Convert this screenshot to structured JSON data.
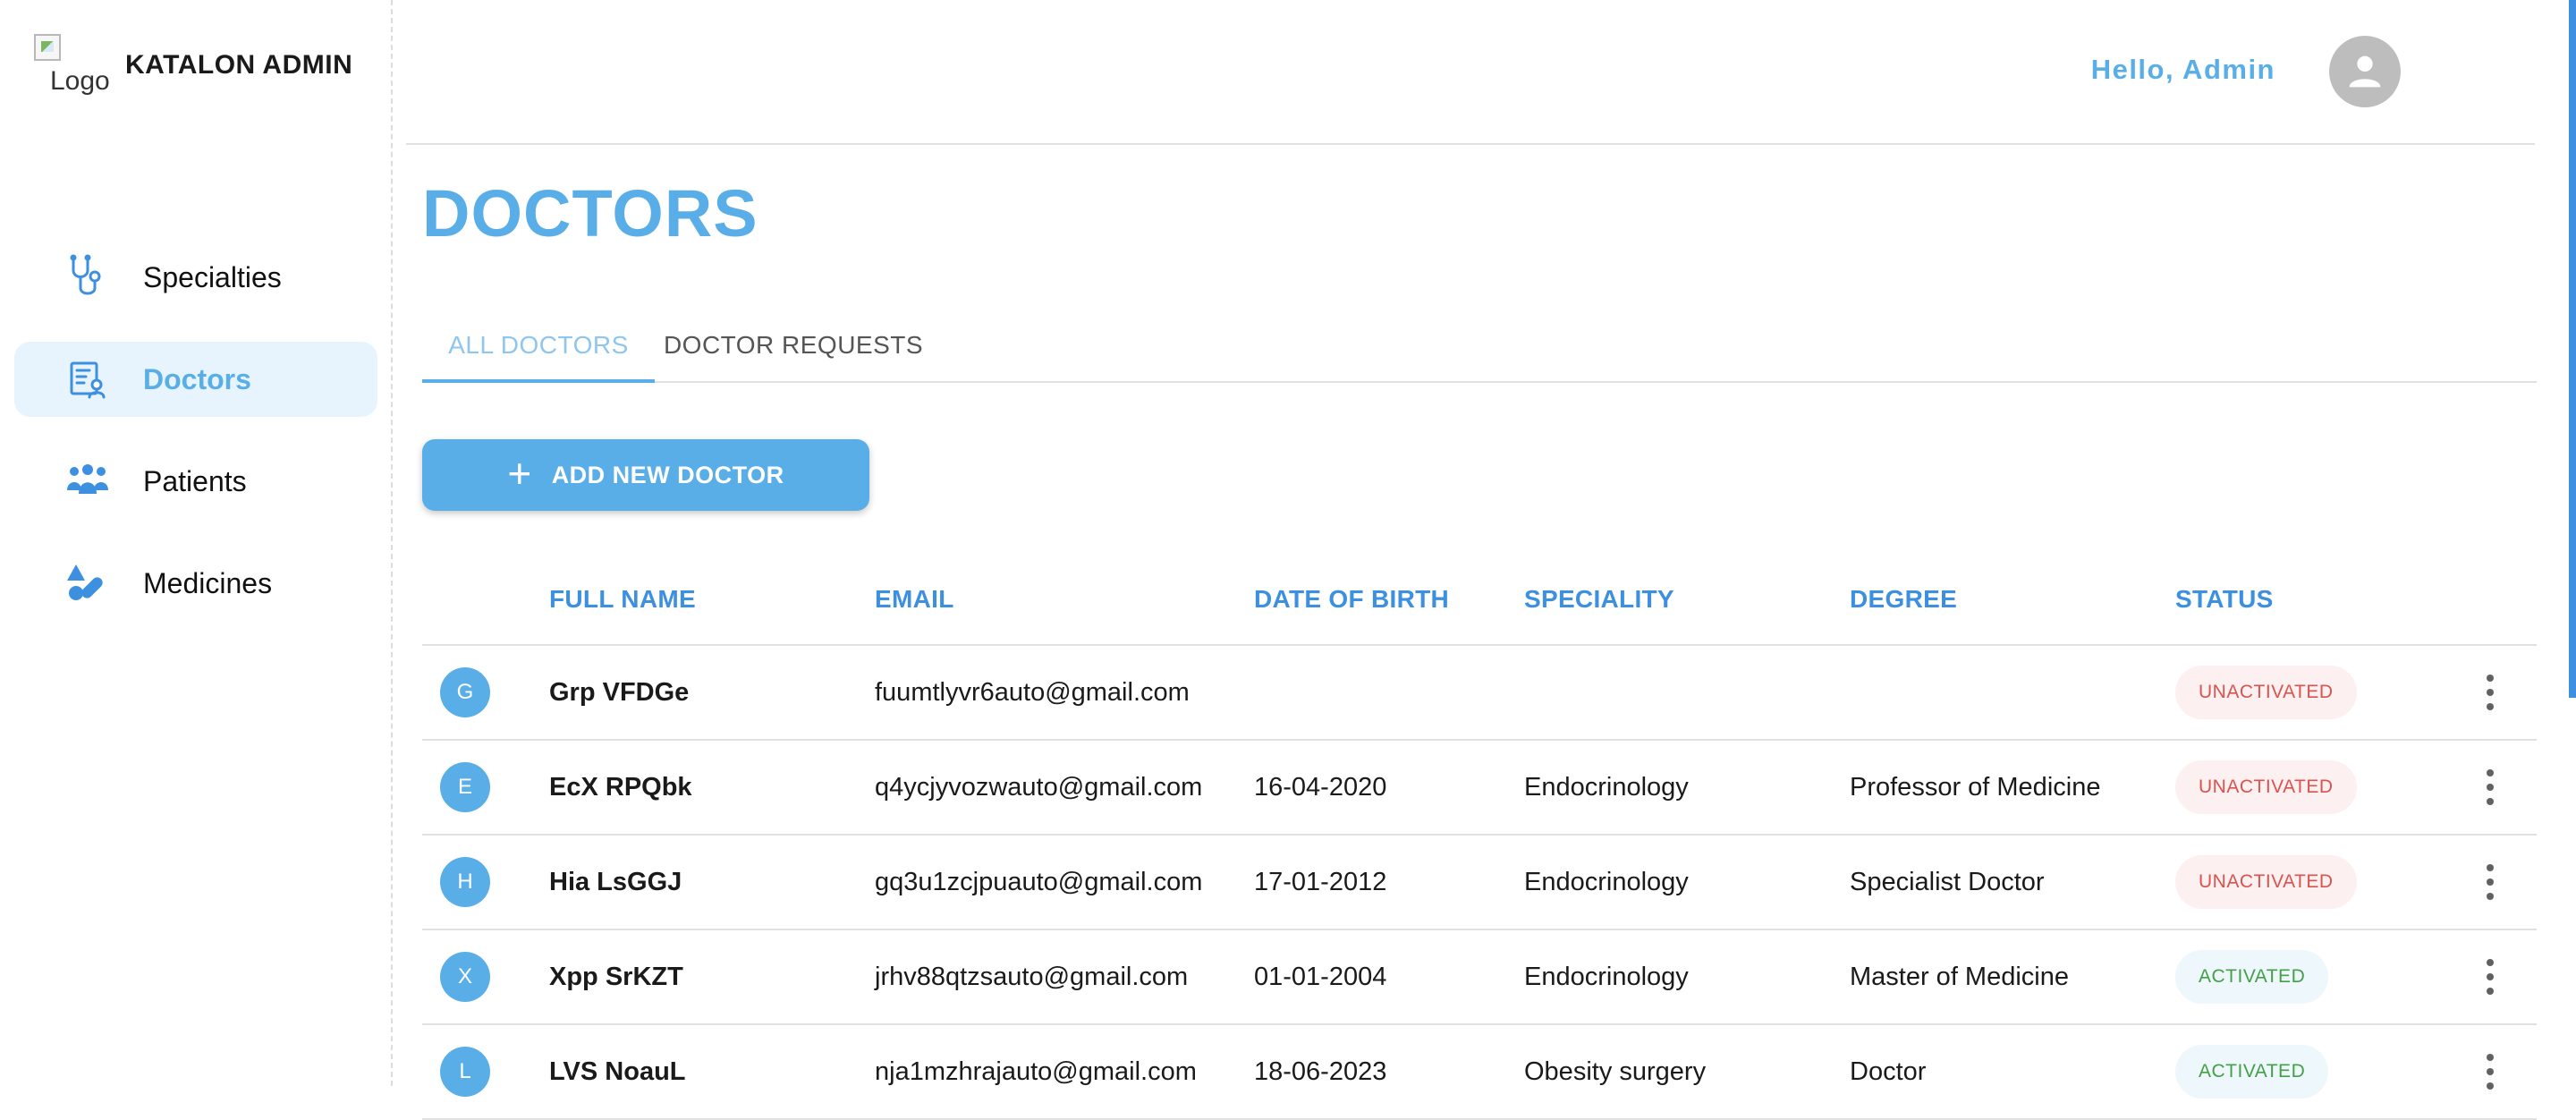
{
  "brand": {
    "logo_alt": "Logo",
    "name": "KATALON ADMIN"
  },
  "sidebar": {
    "items": [
      {
        "label": "Specialties",
        "icon": "stethoscope-icon",
        "active": false
      },
      {
        "label": "Doctors",
        "icon": "doctor-list-icon",
        "active": true
      },
      {
        "label": "Patients",
        "icon": "patients-icon",
        "active": false
      },
      {
        "label": "Medicines",
        "icon": "pills-icon",
        "active": false
      }
    ]
  },
  "header": {
    "greeting": "Hello, Admin",
    "avatar_icon": "account-circle-icon"
  },
  "page": {
    "title": "DOCTORS"
  },
  "tabs": [
    {
      "label": "ALL DOCTORS",
      "active": true
    },
    {
      "label": "DOCTOR REQUESTS",
      "active": false
    }
  ],
  "actions": {
    "add_label": "ADD NEW DOCTOR"
  },
  "table": {
    "columns": {
      "full_name": "FULL NAME",
      "email": "EMAIL",
      "dob": "DATE OF BIRTH",
      "speciality": "SPECIALITY",
      "degree": "DEGREE",
      "status": "STATUS"
    },
    "rows": [
      {
        "initial": "G",
        "full_name": "Grp VFDGe",
        "email": "fuumtlyvr6auto@gmail.com",
        "dob": "",
        "speciality": "",
        "degree": "",
        "status": "UNACTIVATED"
      },
      {
        "initial": "E",
        "full_name": "EcX RPQbk",
        "email": "q4ycjyvozwauto@gmail.com",
        "dob": "16-04-2020",
        "speciality": "Endocrinology",
        "degree": "Professor of Medicine",
        "status": "UNACTIVATED"
      },
      {
        "initial": "H",
        "full_name": "Hia LsGGJ",
        "email": "gq3u1zcjpuauto@gmail.com",
        "dob": "17-01-2012",
        "speciality": "Endocrinology",
        "degree": "Specialist Doctor",
        "status": "UNACTIVATED"
      },
      {
        "initial": "X",
        "full_name": "Xpp SrKZT",
        "email": "jrhv88qtzsauto@gmail.com",
        "dob": "01-01-2004",
        "speciality": "Endocrinology",
        "degree": "Master of Medicine",
        "status": "ACTIVATED"
      },
      {
        "initial": "L",
        "full_name": "LVS NoauL",
        "email": "nja1mzhrajauto@gmail.com",
        "dob": "18-06-2023",
        "speciality": "Obesity surgery",
        "degree": "Doctor",
        "status": "ACTIVATED"
      }
    ]
  },
  "colors": {
    "accent": "#5aaee8",
    "header_blue": "#3d8fe0",
    "unactivated": "#d9534f",
    "activated": "#43a047"
  }
}
